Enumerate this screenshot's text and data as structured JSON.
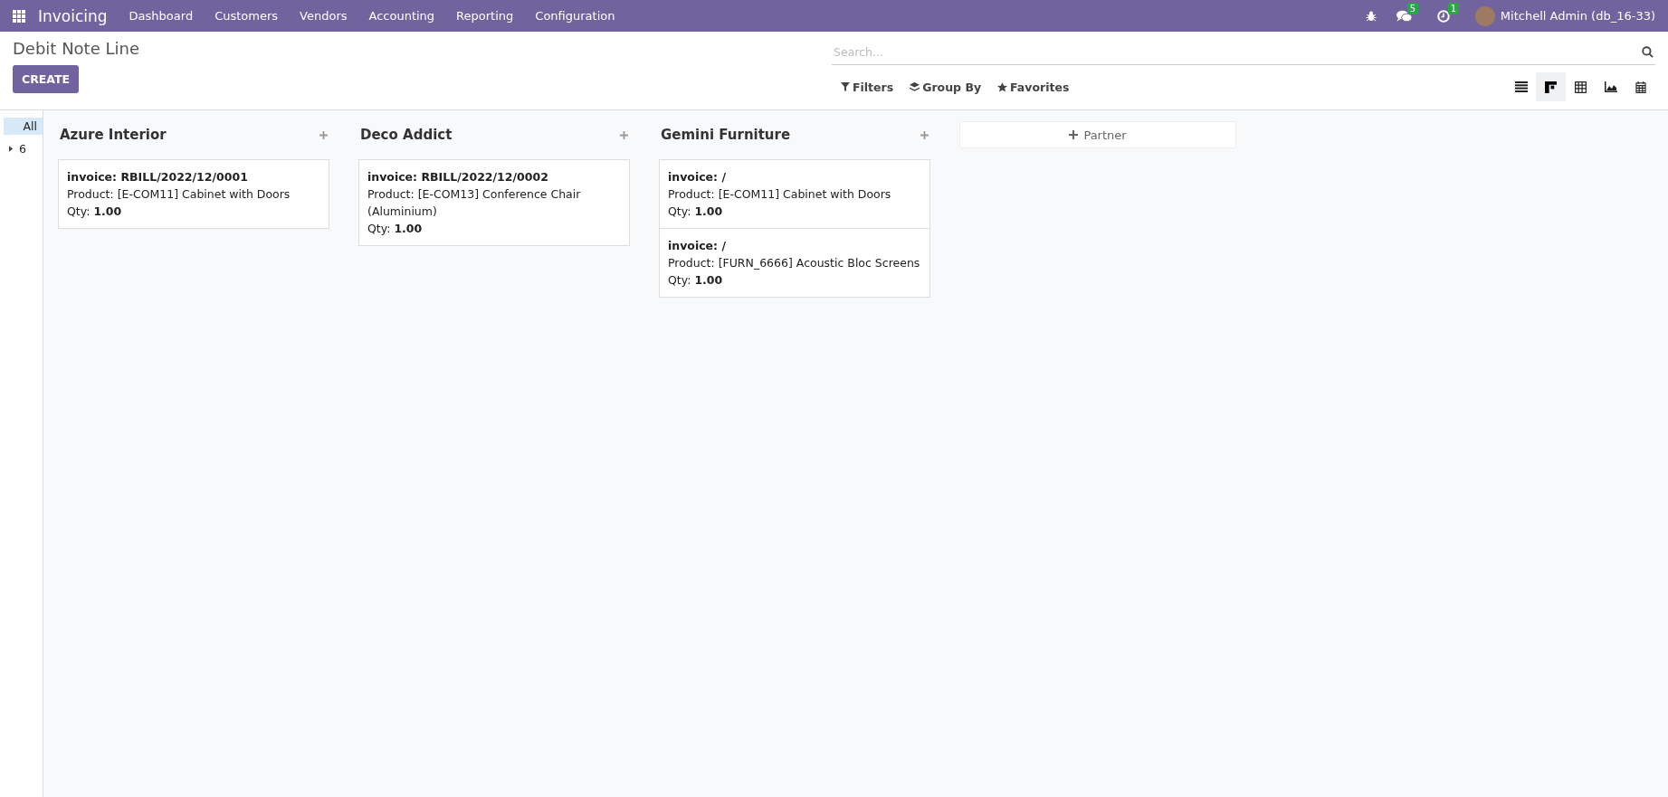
{
  "navbar": {
    "app_name": "Invoicing",
    "menu": [
      "Dashboard",
      "Customers",
      "Vendors",
      "Accounting",
      "Reporting",
      "Configuration"
    ],
    "messages_count": "5",
    "activities_count": "1",
    "user": "Mitchell Admin (db_16-33)"
  },
  "breadcrumb": "Debit Note Line",
  "create_button": "CREATE",
  "search": {
    "placeholder": "Search..."
  },
  "search_options": [
    "Filters",
    "Group By",
    "Favorites"
  ],
  "views": [
    {
      "kind": "list",
      "selected": false
    },
    {
      "kind": "kanban",
      "selected": true
    },
    {
      "kind": "pivot",
      "selected": false
    },
    {
      "kind": "graph",
      "selected": false
    },
    {
      "kind": "calendar",
      "selected": false
    }
  ],
  "side_panel": [
    {
      "label": "All",
      "selected": true
    },
    {
      "label": "6",
      "selected": false,
      "expanded": false
    }
  ],
  "columns": [
    {
      "title": "Azure Interior",
      "cards": [
        {
          "invoice": "invoice: RBILL/2022/12/0001",
          "product": "Product: [E-COM11] Cabinet with Doors",
          "qty": "Qty: **1.00**"
        }
      ]
    },
    {
      "title": "Deco Addict",
      "cards": [
        {
          "invoice": "invoice: RBILL/2022/12/0002",
          "product": "Product: [E-COM13] Conference Chair (Aluminium)",
          "qty": "Qty: **1.00**"
        }
      ]
    },
    {
      "title": "Gemini Furniture",
      "cards": [
        {
          "invoice": "invoice: /",
          "product": "Product: [E-COM11] Cabinet with Doors",
          "qty": "Qty: **1.00**"
        },
        {
          "invoice": "invoice: /",
          "product": "Product: [FURN_6666] Acoustic Bloc Screens",
          "qty": "Qty: **1.00**"
        }
      ]
    }
  ],
  "add_column": "Partner"
}
